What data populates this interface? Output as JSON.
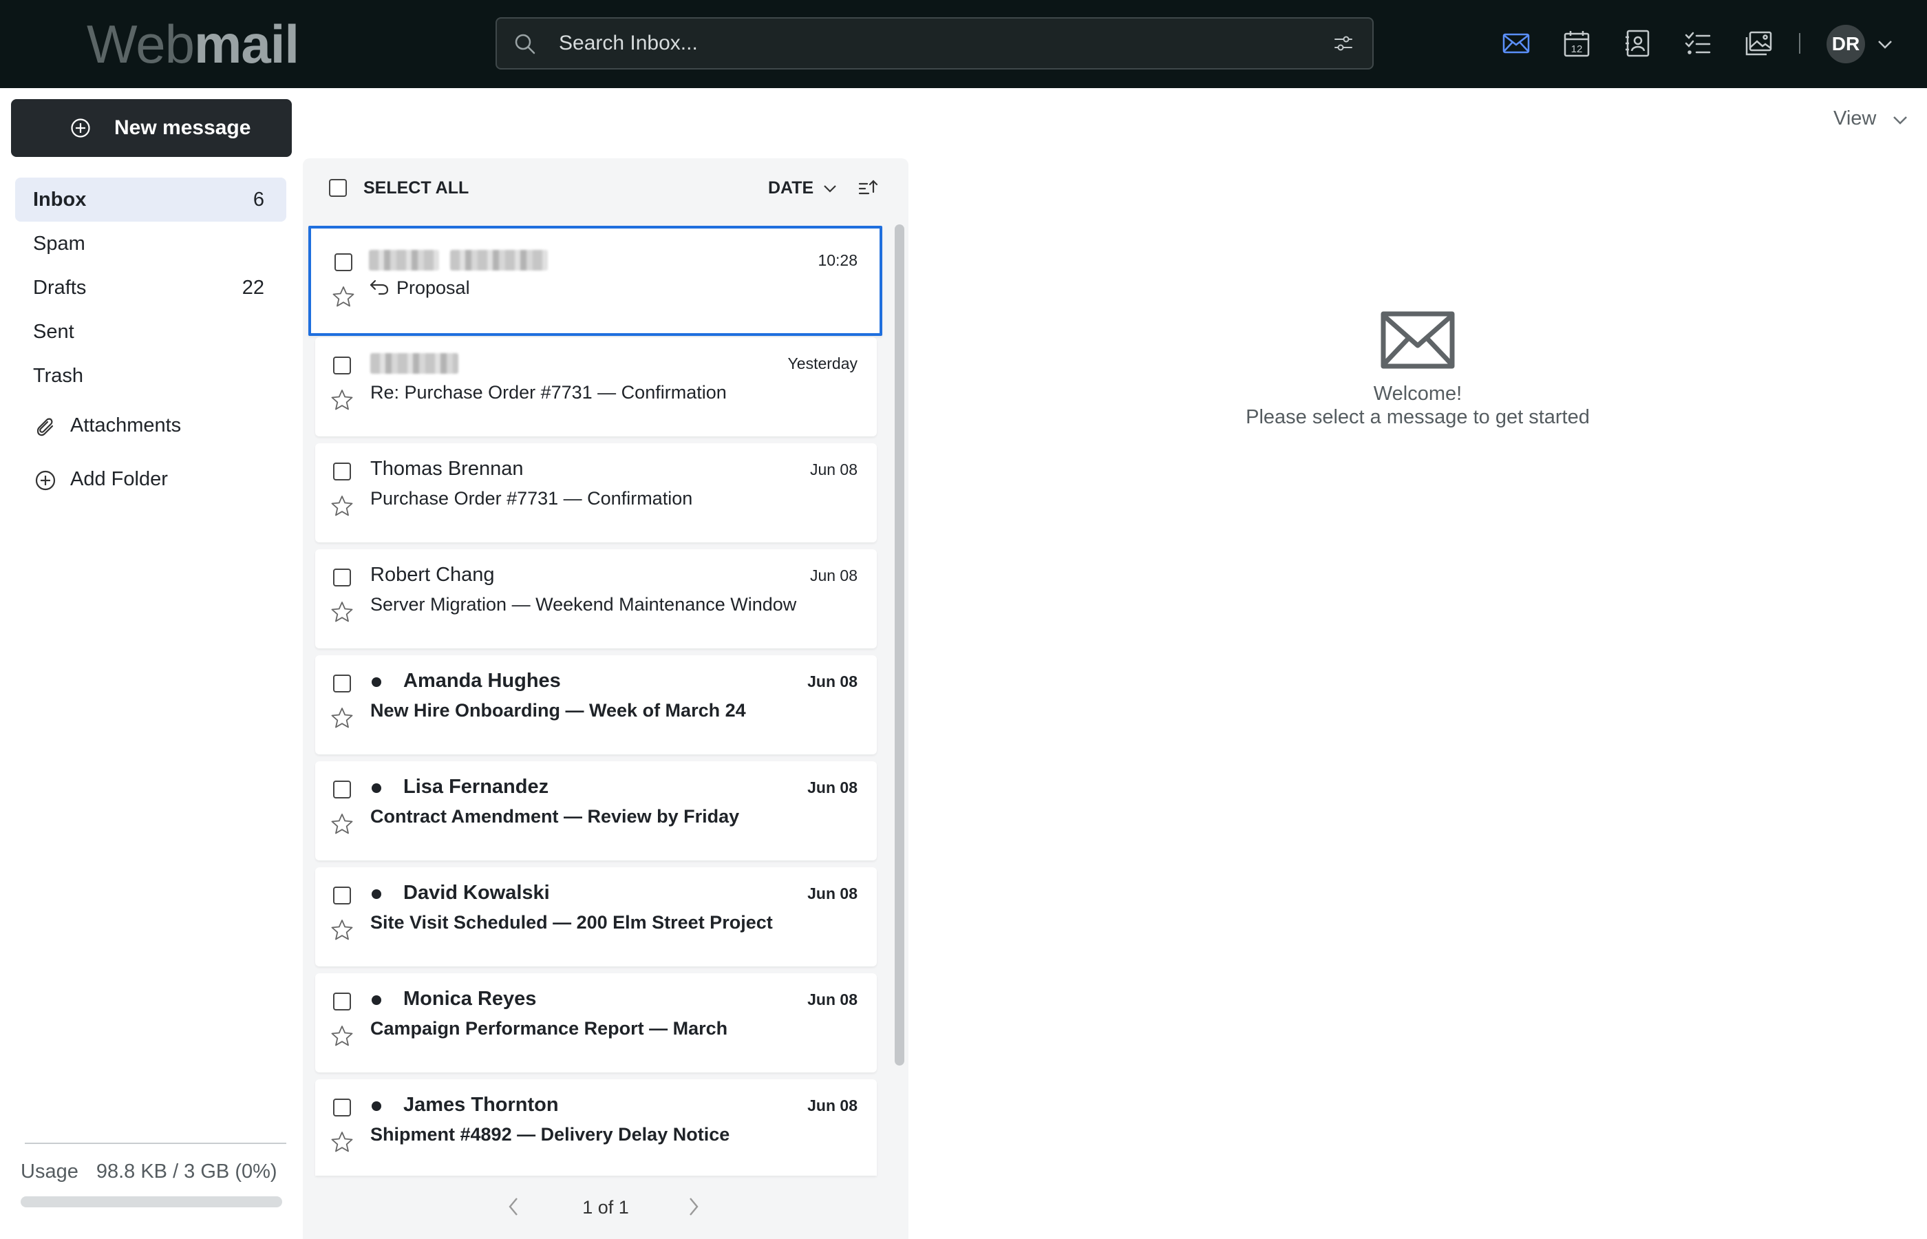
{
  "app": {
    "logo_light": "Web",
    "logo_bold": "mail"
  },
  "search": {
    "placeholder": "Search Inbox..."
  },
  "toolbar": {
    "icons": [
      "mail-icon",
      "calendar-icon",
      "contacts-icon",
      "tasks-icon",
      "photos-icon"
    ],
    "calendar_day": "12",
    "active_color": "#5b8ff9"
  },
  "user": {
    "initials": "DR"
  },
  "sidebar": {
    "new_message_label": "New message",
    "folders": [
      {
        "name": "Inbox",
        "count": "6",
        "active": true
      },
      {
        "name": "Spam",
        "count": ""
      },
      {
        "name": "Drafts",
        "count": "22"
      },
      {
        "name": "Sent",
        "count": ""
      },
      {
        "name": "Trash",
        "count": ""
      }
    ],
    "attachments_label": "Attachments",
    "add_folder_label": "Add Folder",
    "usage_label": "Usage",
    "usage_value": "98.8 KB / 3 GB (0%)",
    "usage_fraction": 0
  },
  "view_button_label": "View",
  "list": {
    "select_all_label": "SELECT ALL",
    "sort_label": "DATE",
    "emails": [
      {
        "from": "",
        "subject": "Proposal",
        "date": "10:28",
        "selected": true,
        "unread": false,
        "replied": true
      },
      {
        "from": "",
        "subject": "Re: Purchase Order #7731 — Confirmation",
        "date": "Yesterday",
        "unread": false
      },
      {
        "from": "Thomas Brennan",
        "subject": "Purchase Order #7731 — Confirmation",
        "date": "Jun 08",
        "unread": false
      },
      {
        "from": "Robert Chang",
        "subject": "Server Migration — Weekend Maintenance Window",
        "date": "Jun 08",
        "unread": false
      },
      {
        "from": "Amanda Hughes",
        "subject": "New Hire Onboarding — Week of March 24",
        "date": "Jun 08",
        "unread": true
      },
      {
        "from": "Lisa Fernandez",
        "subject": "Contract Amendment — Review by Friday",
        "date": "Jun 08",
        "unread": true
      },
      {
        "from": "David Kowalski",
        "subject": "Site Visit Scheduled — 200 Elm Street Project",
        "date": "Jun 08",
        "unread": true
      },
      {
        "from": "Monica Reyes",
        "subject": "Campaign Performance Report — March",
        "date": "Jun 08",
        "unread": true
      },
      {
        "from": "James Thornton",
        "subject": "Shipment #4892 — Delivery Delay Notice",
        "date": "Jun 08",
        "unread": true
      }
    ],
    "pagination": "1 of 1"
  },
  "reading_pane": {
    "welcome_title": "Welcome!",
    "welcome_subtitle": "Please select a message to get started"
  }
}
